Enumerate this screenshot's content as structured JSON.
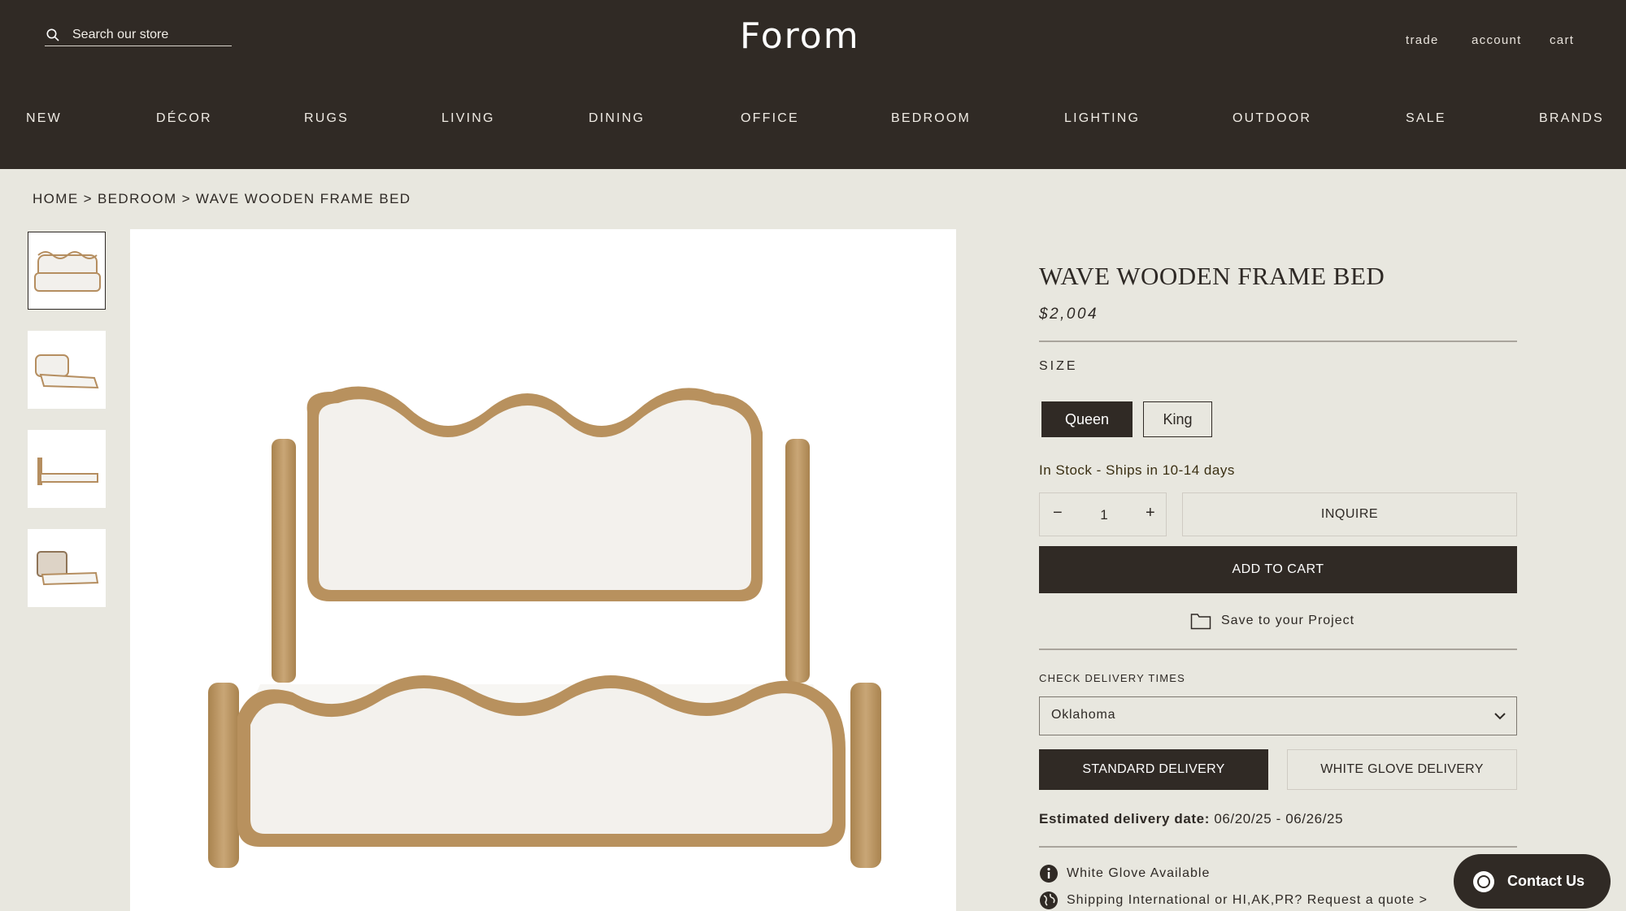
{
  "header": {
    "search_placeholder": "Search our store",
    "logo": "Forom",
    "links": {
      "trade": "trade",
      "account": "account",
      "cart": "cart"
    },
    "nav": [
      "NEW",
      "DÉCOR",
      "RUGS",
      "LIVING",
      "DINING",
      "OFFICE",
      "BEDROOM",
      "LIGHTING",
      "OUTDOOR",
      "SALE",
      "BRANDS"
    ]
  },
  "breadcrumb": [
    "HOME",
    ">",
    "BEDROOM",
    ">",
    "WAVE WOODEN FRAME BED"
  ],
  "product": {
    "title": "WAVE WOODEN FRAME BED",
    "price": "$2,004",
    "size_label": "SIZE",
    "sizes": [
      "Queen",
      "King"
    ],
    "selected_size": "Queen",
    "stock": "In Stock - Ships in 10-14 days",
    "quantity": {
      "minus": "−",
      "value": "1",
      "plus": "+"
    },
    "inquire": "INQUIRE",
    "add_to_cart": "ADD TO CART",
    "save": "Save to your Project",
    "delivery_label": "CHECK DELIVERY TIMES",
    "state": "Oklahoma",
    "delivery_options": [
      "STANDARD DELIVERY",
      "WHITE GLOVE DELIVERY"
    ],
    "selected_delivery": "STANDARD DELIVERY",
    "estimate_label": "Estimated delivery date:",
    "estimate_value": "06/20/25 - 06/26/25",
    "white_glove": "White Glove Available",
    "shipping": "Shipping International or HI,AK,PR? Request a quote >"
  },
  "gallery": {
    "thumbnail_count": 4,
    "active_index": 0
  },
  "contact": "Contact Us",
  "colors": {
    "header_bg": "#302a25",
    "page_bg": "#e8e7df",
    "accent": "#302a25",
    "stock_text": "#3a2f12"
  }
}
